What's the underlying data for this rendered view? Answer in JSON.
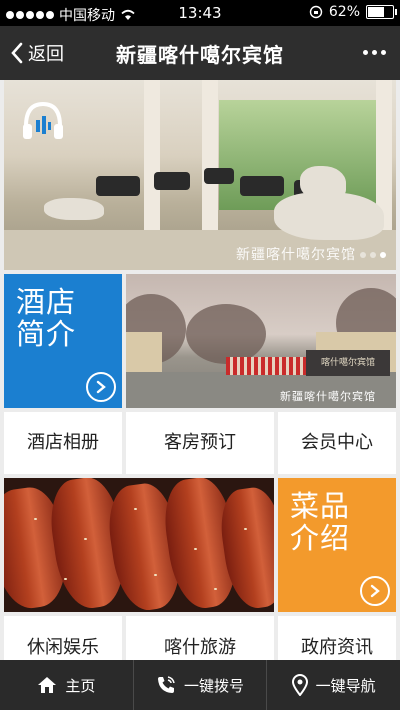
{
  "status": {
    "carrier": "中国移动",
    "time": "13:43",
    "battery": "62%"
  },
  "nav": {
    "back": "返回",
    "title": "新疆喀什噶尔宾馆"
  },
  "hero": {
    "caption": "新疆喀什噶尔宾馆"
  },
  "tiles": {
    "intro": "酒店简介",
    "dishes": "菜品介绍"
  },
  "gate": {
    "sign": "喀什噶尔宾馆",
    "caption": "新疆喀什噶尔宾馆"
  },
  "menu": {
    "album": "酒店相册",
    "booking": "客房预订",
    "member": "会员中心",
    "leisure": "休闲娱乐",
    "tourism": "喀什旅游",
    "gov": "政府资讯"
  },
  "tabs": {
    "home": "主页",
    "call": "一键拨号",
    "navi": "一键导航"
  },
  "colors": {
    "blue": "#1b7fd0",
    "orange": "#f39a2c",
    "bar": "#2a2a2a"
  }
}
